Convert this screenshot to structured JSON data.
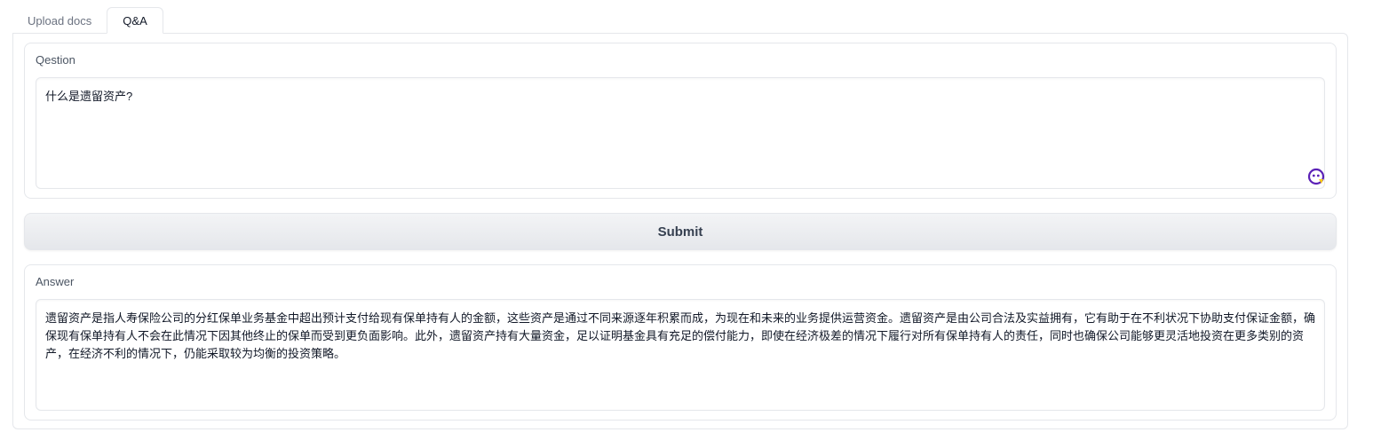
{
  "tabs": [
    {
      "label": "Upload docs",
      "active": false
    },
    {
      "label": "Q&A",
      "active": true
    }
  ],
  "question": {
    "label": "Qestion",
    "value": "什么是遗留资产?"
  },
  "submit": {
    "label": "Submit"
  },
  "answer": {
    "label": "Answer",
    "value": "遗留资产是指人寿保险公司的分红保单业务基金中超出预计支付给现有保单持有人的金额，这些资产是通过不同来源逐年积累而成，为现在和未来的业务提供运营资金。遗留资产是由公司合法及实益拥有，它有助于在不利状况下协助支付保证金额，确保现有保单持有人不会在此情况下因其他终止的保单而受到更负面影响。此外，遗留资产持有大量资金，足以证明基金具有充足的偿付能力，即使在经济极差的情况下履行对所有保单持有人的责任，同时也确保公司能够更灵活地投资在更多类别的资产，在经济不利的情况下，仍能采取较为均衡的投资策略。"
  },
  "icons": {
    "grammar_assistant": "grammar-assistant-icon"
  },
  "colors": {
    "assistant_purple": "#5b21b6",
    "assistant_yellow": "#facc15"
  }
}
